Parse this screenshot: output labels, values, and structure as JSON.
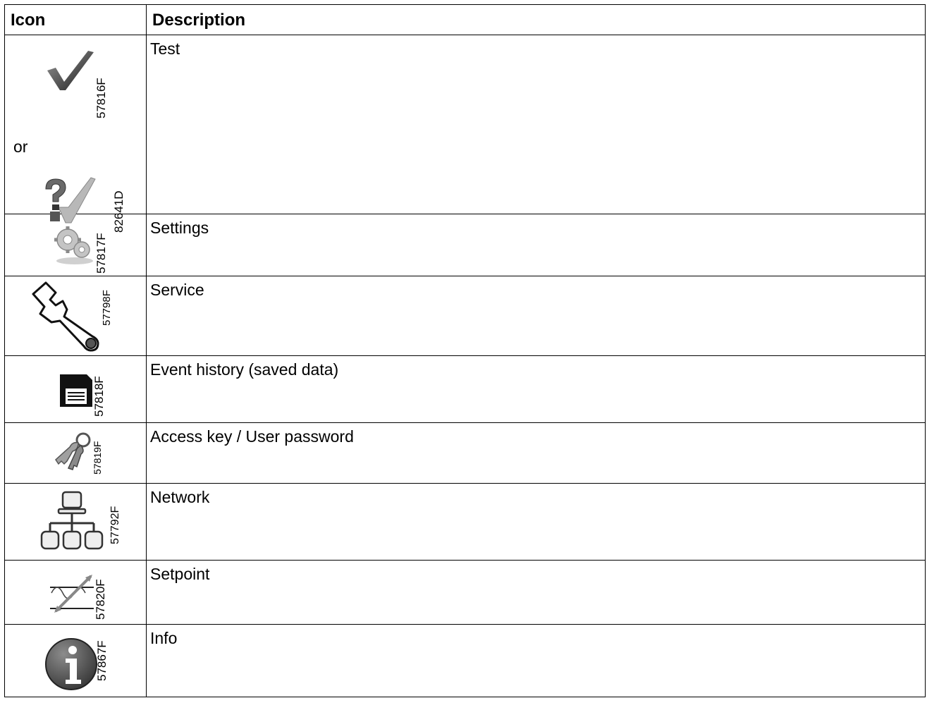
{
  "header": {
    "icon_col": "Icon",
    "desc_col": "Description"
  },
  "rows": [
    {
      "description": "Test",
      "icon": "checkmark-icon",
      "code": "57816F",
      "alt_label": "or",
      "alt_icon": "question-checkmark-icon",
      "alt_code": "82641D"
    },
    {
      "description": "Settings",
      "icon": "gears-icon",
      "code": "57817F"
    },
    {
      "description": "Service",
      "icon": "wrench-icon",
      "code": "57798F"
    },
    {
      "description": "Event history (saved data)",
      "icon": "floppy-disk-icon",
      "code": "57818F"
    },
    {
      "description": "Access key / User password",
      "icon": "keys-icon",
      "code": "57819F"
    },
    {
      "description": "Network",
      "icon": "network-icon",
      "code": "57792F"
    },
    {
      "description": "Setpoint",
      "icon": "setpoint-icon",
      "code": "57820F"
    },
    {
      "description": "Info",
      "icon": "info-icon",
      "code": "57867F"
    }
  ]
}
